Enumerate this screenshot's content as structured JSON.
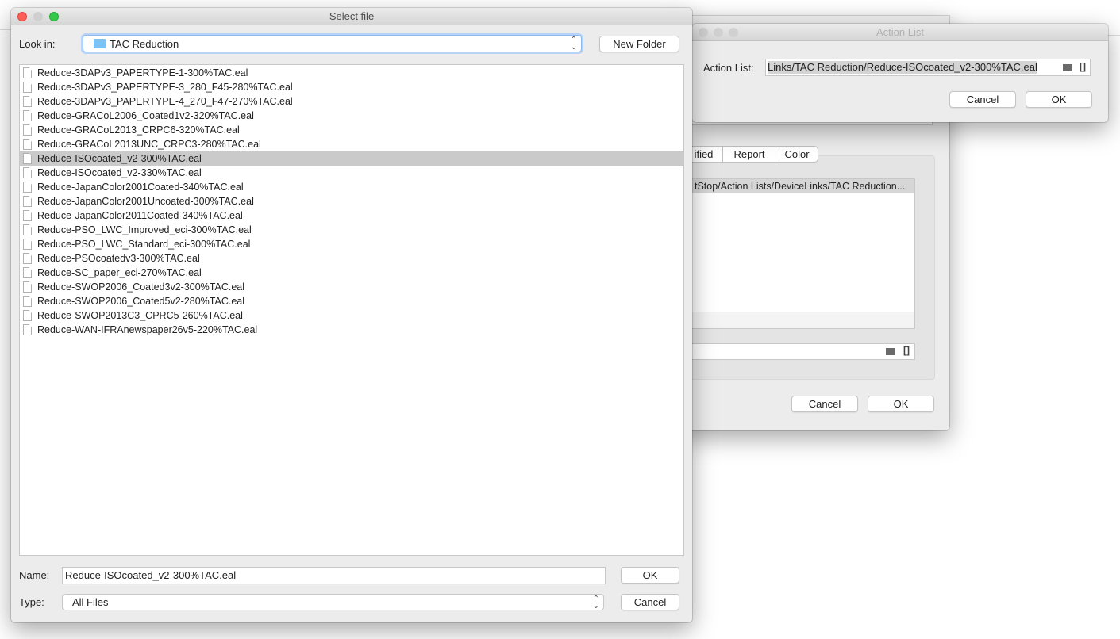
{
  "background_window": {
    "tabs": [
      "ified",
      "Report",
      "Color"
    ],
    "table_header": "tStop/Action Lists/DeviceLinks/TAC Reduction...",
    "path_field_value": "",
    "cancel_label": "Cancel",
    "ok_label": "OK"
  },
  "action_list_dialog": {
    "title": "Action List",
    "field_label": "Action List:",
    "field_value": "Links/TAC Reduction/Reduce-ISOcoated_v2-300%TAC.eal",
    "bracket_icon": "[]",
    "cancel_label": "Cancel",
    "ok_label": "OK"
  },
  "select_file_dialog": {
    "title": "Select file",
    "look_in_label": "Look in:",
    "look_in_value": "TAC Reduction",
    "new_folder_label": "New Folder",
    "files": [
      "Reduce-3DAPv3_PAPERTYPE-1-300%TAC.eal",
      "Reduce-3DAPv3_PAPERTYPE-3_280_F45-280%TAC.eal",
      "Reduce-3DAPv3_PAPERTYPE-4_270_F47-270%TAC.eal",
      "Reduce-GRACoL2006_Coated1v2-320%TAC.eal",
      "Reduce-GRACoL2013_CRPC6-320%TAC.eal",
      "Reduce-GRACoL2013UNC_CRPC3-280%TAC.eal",
      "Reduce-ISOcoated_v2-300%TAC.eal",
      "Reduce-ISOcoated_v2-330%TAC.eal",
      "Reduce-JapanColor2001Coated-340%TAC.eal",
      "Reduce-JapanColor2001Uncoated-300%TAC.eal",
      "Reduce-JapanColor2011Coated-340%TAC.eal",
      "Reduce-PSO_LWC_Improved_eci-300%TAC.eal",
      "Reduce-PSO_LWC_Standard_eci-300%TAC.eal",
      "Reduce-PSOcoatedv3-300%TAC.eal",
      "Reduce-SC_paper_eci-270%TAC.eal",
      "Reduce-SWOP2006_Coated3v2-300%TAC.eal",
      "Reduce-SWOP2006_Coated5v2-280%TAC.eal",
      "Reduce-SWOP2013C3_CPRC5-260%TAC.eal",
      "Reduce-WAN-IFRAnewspaper26v5-220%TAC.eal"
    ],
    "selected_index": 6,
    "name_label": "Name:",
    "name_value": "Reduce-ISOcoated_v2-300%TAC.eal",
    "type_label": "Type:",
    "type_value": "All Files",
    "ok_label": "OK",
    "cancel_label": "Cancel"
  }
}
